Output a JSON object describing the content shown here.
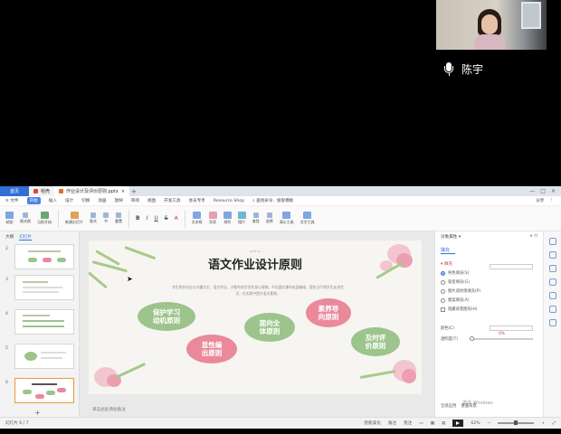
{
  "meeting": {
    "speaker_name": "陈宇"
  },
  "tabs": {
    "home": "首页",
    "stencil": "稻壳",
    "document": "作业设计及评价原则.pptx"
  },
  "menu": {
    "items": [
      "≡ 文件",
      "开始",
      "插入",
      "设计",
      "切换",
      "动画",
      "放映",
      "审阅",
      "视图",
      "开发工具",
      "会员专享",
      "Resource Shop"
    ],
    "active_index": 1,
    "search": "查找命令、搜索模板",
    "share": "分享"
  },
  "ribbon": {
    "buttons": [
      "粘贴",
      "格式刷",
      "当前开始",
      "新建幻灯片",
      "版式",
      "节",
      "重置",
      "B",
      "I",
      "U",
      "S",
      "A",
      "文本框",
      "形状",
      "排列",
      "图片",
      "查找",
      "选择",
      "演示工具",
      "文字工具"
    ]
  },
  "thumbnails": {
    "tabs": [
      "大纲",
      "幻灯片"
    ],
    "numbers": [
      "2",
      "3",
      "4",
      "5",
      "6"
    ],
    "selected": "6"
  },
  "slide": {
    "tiny_label": "PART 02",
    "title": "语文作业设计原则",
    "subtitle": "学生的作业应以兴趣为主，语文作业，才能符合学生的身心规律。不仅要在课内巩固基础，更应当引领学生走进生活，在实践中提升语文素养。",
    "principles": [
      "保护学习\n动机原则",
      "面向全\n体原则",
      "素养导\n向原则",
      "显性编\n出原则",
      "及时评\n价原则"
    ]
  },
  "notes_placeholder": "单击此处添加备注",
  "properties": {
    "header": "对象属性 ▾",
    "tab": "填充",
    "section": "▾ 填充",
    "options": [
      "纯色填充(S)",
      "渐变填充(G)",
      "图片或纹理填充(P)",
      "图案填充(A)",
      "隐藏背景图形(H)"
    ],
    "selected_option": 0,
    "color_label": "颜色(C)",
    "transparency_label": "透明度(T)",
    "transparency_value": "0%",
    "apply_all": "全部应用",
    "reset": "重置背景",
    "activate_watermark": "激活 Windows"
  },
  "status": {
    "slide_counter": "幻灯片 6 / 7",
    "smart_beautify": "智能美化",
    "notes": "备注",
    "comments": "批注",
    "zoom": "62%"
  }
}
